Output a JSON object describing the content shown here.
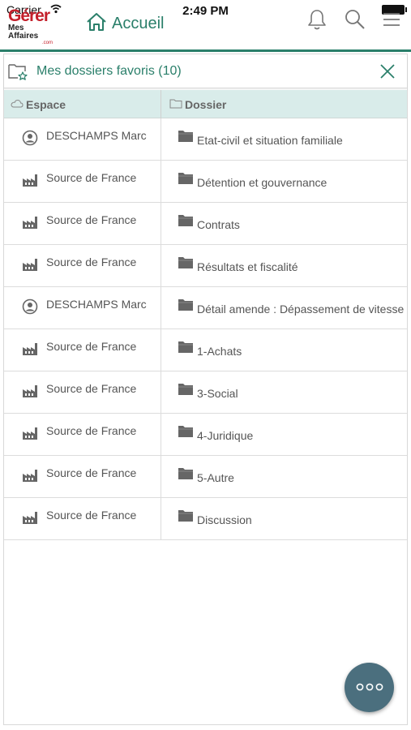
{
  "status": {
    "carrier": "Carrier",
    "time": "2:49 PM"
  },
  "logo": {
    "line1": "Gérer",
    "line2": "Mes Affaires",
    "line3": ".com"
  },
  "header": {
    "home_label": "Accueil"
  },
  "panel": {
    "title": "Mes dossiers favoris (10)"
  },
  "table": {
    "headers": [
      "Espace",
      "Dossier"
    ],
    "rows": [
      {
        "espace": "DESCHAMPS Marc",
        "espace_icon": "person-icon",
        "dossier": "Etat-civil et situation familiale"
      },
      {
        "espace": "Source de France",
        "espace_icon": "factory-icon",
        "dossier": "Détention et gouvernance"
      },
      {
        "espace": "Source de France",
        "espace_icon": "factory-icon",
        "dossier": "Contrats"
      },
      {
        "espace": "Source de France",
        "espace_icon": "factory-icon",
        "dossier": "Résultats et fiscalité"
      },
      {
        "espace": "DESCHAMPS Marc",
        "espace_icon": "person-icon",
        "dossier": "Détail amende : Dépassement de vitesse"
      },
      {
        "espace": "Source de France",
        "espace_icon": "factory-icon",
        "dossier": "1-Achats"
      },
      {
        "espace": "Source de France",
        "espace_icon": "factory-icon",
        "dossier": "3-Social"
      },
      {
        "espace": "Source de France",
        "espace_icon": "factory-icon",
        "dossier": "4-Juridique"
      },
      {
        "espace": "Source de France",
        "espace_icon": "factory-icon",
        "dossier": "5-Autre"
      },
      {
        "espace": "Source de France",
        "espace_icon": "factory-icon",
        "dossier": "Discussion"
      }
    ]
  },
  "colors": {
    "accent": "#2a7f6a",
    "header_row": "#d9ecea",
    "fab": "#4b6f7e",
    "brand_red": "#c4202b"
  }
}
